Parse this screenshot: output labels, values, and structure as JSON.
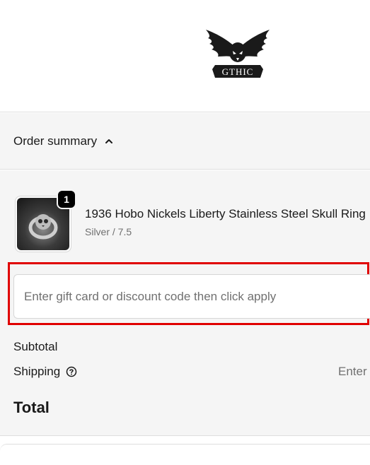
{
  "brand": {
    "name": "GTHIC",
    "logo_icon": "eagle-skull-logo-icon"
  },
  "order_summary": {
    "toggle_label": "Order summary",
    "toggle_icon": "chevron-up-icon"
  },
  "line_item": {
    "quantity": "1",
    "title": "1936 Hobo Nickels Liberty Stainless Steel Skull Ring",
    "variant": "Silver / 7.5",
    "image_icon": "skull-ring-product-image"
  },
  "discount": {
    "placeholder": "Enter gift card or discount code then click apply",
    "value": ""
  },
  "totals": {
    "subtotal_label": "Subtotal",
    "shipping_label": "Shipping",
    "shipping_value": "Enter",
    "shipping_help_icon": "question-circle-icon",
    "total_label": "Total"
  },
  "colors": {
    "highlight": "#e00000",
    "panel_bg": "#f5f5f5",
    "badge_bg": "#000000"
  }
}
